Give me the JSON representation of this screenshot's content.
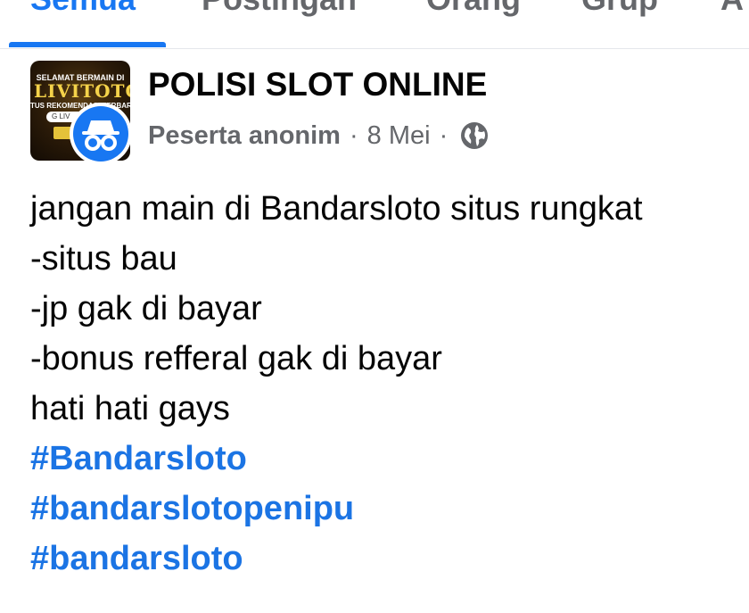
{
  "tabs": [
    {
      "label": "Semua",
      "active": true
    },
    {
      "label": "Postingan",
      "active": false
    },
    {
      "label": "Orang",
      "active": false
    },
    {
      "label": "Grup",
      "active": false
    },
    {
      "label": "A",
      "active": false
    }
  ],
  "post": {
    "group_avatar_text": {
      "top": "SELAMAT BERMAIN DI",
      "logo": "LIVITOTO",
      "mid": "TUS REKOMENDASI TERBARU",
      "bar": "G  LIV"
    },
    "group_name": "POLISI SLOT ONLINE",
    "author": "Peserta anonim",
    "separator": "·",
    "date": "8 Mei",
    "privacy_icon": "globe-icon",
    "lines": [
      "jangan main di Bandarsloto situs rungkat",
      "-situs bau",
      "-jp gak di bayar",
      "-bonus refferal gak di bayar",
      "hati hati gays"
    ],
    "hashtags": [
      "#Bandarsloto",
      "#bandarslotopenipu",
      "#bandarsloto"
    ]
  },
  "colors": {
    "accent": "#1877f2",
    "hashtag": "#1b74e4",
    "secondary_text": "#65676b",
    "primary_text": "#050505"
  }
}
